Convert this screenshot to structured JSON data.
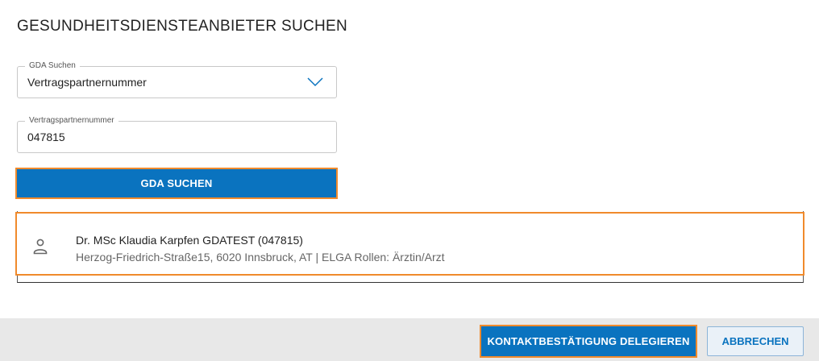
{
  "dialog": {
    "title": "GESUNDHEITSDIENSTEANBIETER SUCHEN"
  },
  "search_type": {
    "label": "GDA Suchen",
    "selected": "Vertragspartnernummer"
  },
  "partner_number": {
    "label": "Vertragspartnernummer",
    "value": "047815"
  },
  "search_button": {
    "label": "GDA SUCHEN"
  },
  "results": [
    {
      "icon": "person-icon",
      "name": "Dr. MSc Klaudia Karpfen GDATEST (047815)",
      "details": "Herzog-Friedrich-Straße15, 6020 Innsbruck, AT | ELGA Rollen: Ärztin/Arzt"
    }
  ],
  "footer": {
    "delegate_label": "KONTAKTBESTÄTIGUNG DELEGIEREN",
    "cancel_label": "ABBRECHEN"
  },
  "colors": {
    "primary": "#0a73bf",
    "highlight": "#f08a2c",
    "footer_bg": "#e8e8e8"
  }
}
